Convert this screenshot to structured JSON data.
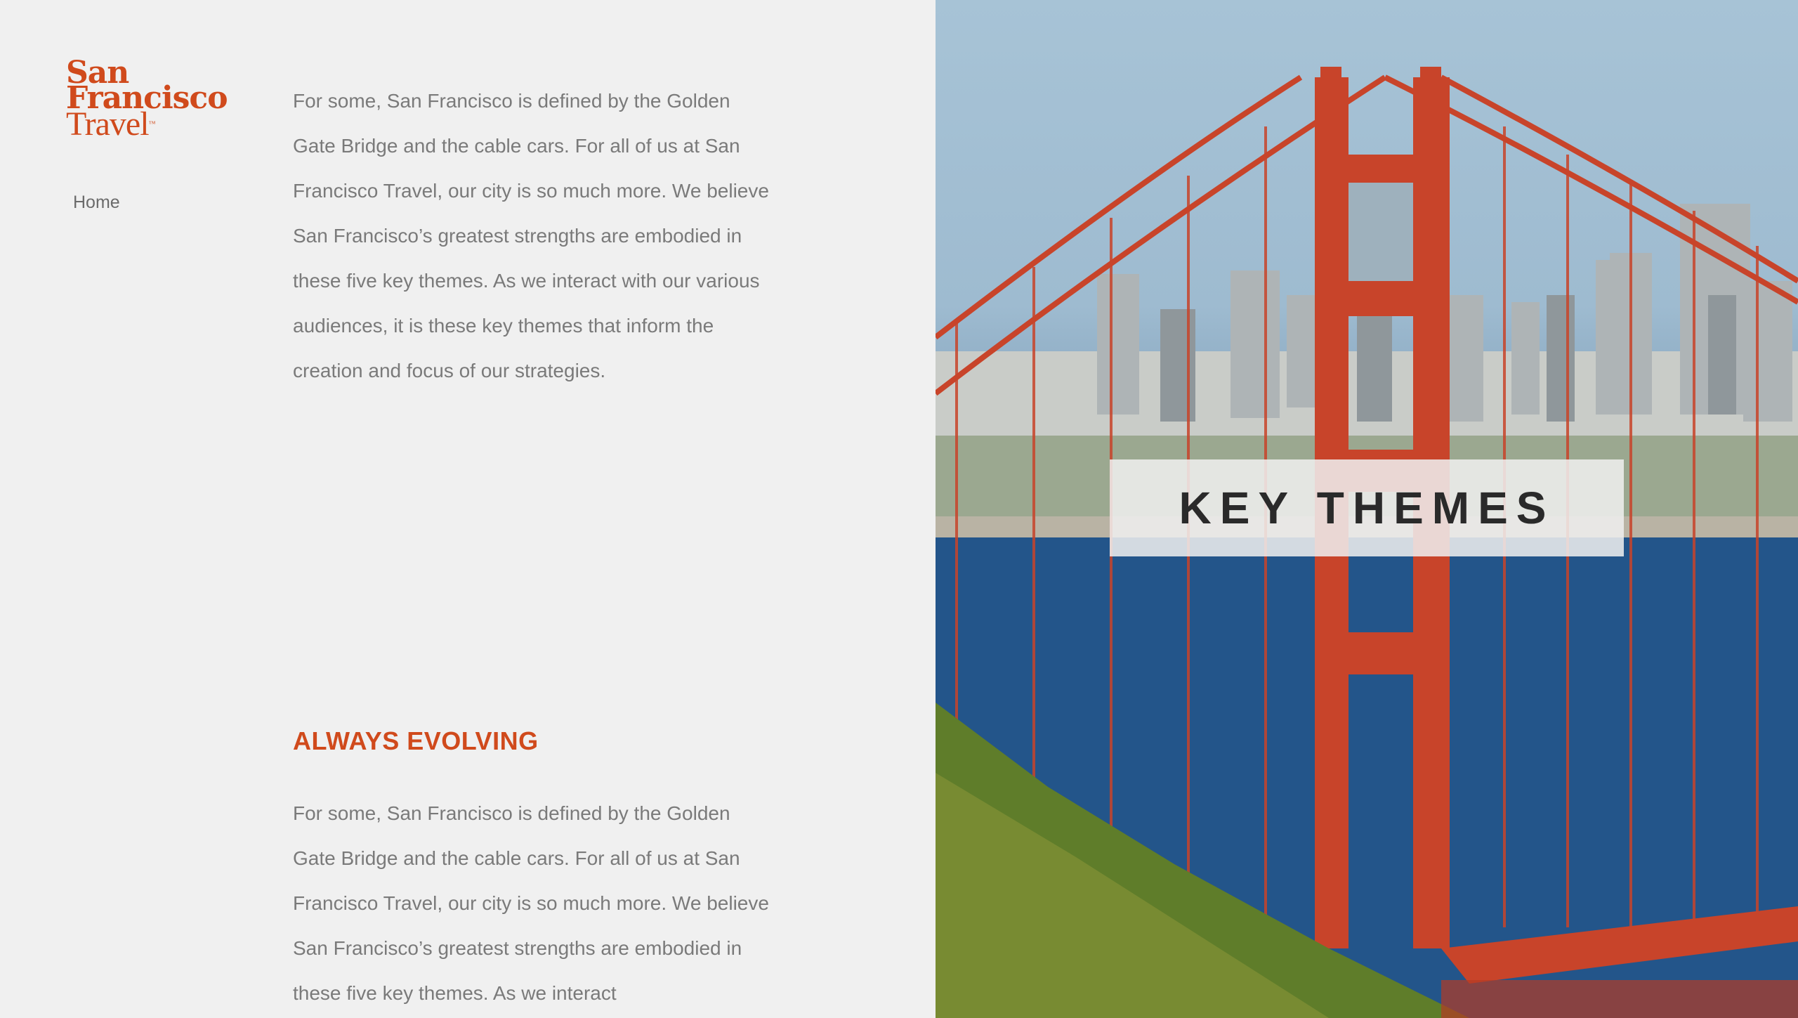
{
  "brand": {
    "line1": "San",
    "line2": "Francisco",
    "line3": "Travel",
    "trademark": "™",
    "color": "#d04a1c"
  },
  "nav": {
    "items": [
      {
        "label": "Home"
      }
    ]
  },
  "intro": {
    "paragraph": "For some, San Francisco is defined by the Golden Gate Bridge and the cable cars. For all of us at San Francisco Travel, our city is so much more. We believe San Francisco’s greatest strengths are embodied in these five key themes. As we interact with our various audiences, it is these key themes that inform the creation and focus of our strategies."
  },
  "section": {
    "heading": "ALWAYS EVOLVING",
    "paragraph": "For some, San Francisco is defined by the Golden Gate Bridge and the cable cars. For all of us at San Francisco Travel, our city is so much more. We believe San Francisco’s greatest strengths are embodied in these five key themes. As we interact"
  },
  "hero": {
    "title": "KEY THEMES",
    "image": "golden-gate-bridge-photo"
  },
  "colors": {
    "accent": "#d04a1c",
    "body_text": "#7a7a7a",
    "background": "#f0f0f0",
    "bridge": "#c8442a"
  }
}
